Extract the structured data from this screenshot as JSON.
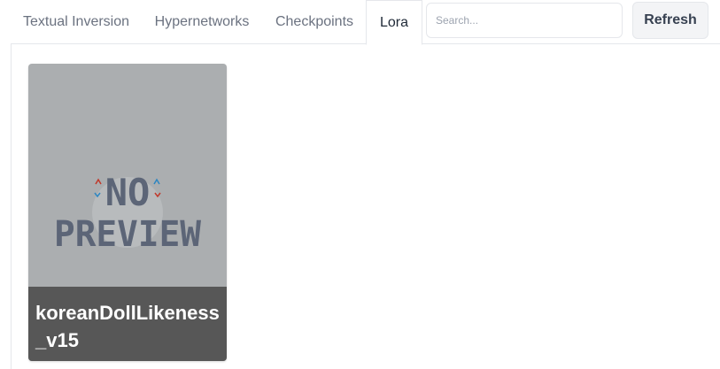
{
  "tabs": [
    {
      "label": "Textual Inversion",
      "active": false
    },
    {
      "label": "Hypernetworks",
      "active": false
    },
    {
      "label": "Checkpoints",
      "active": false
    },
    {
      "label": "Lora",
      "active": true
    }
  ],
  "search": {
    "placeholder": "Search...",
    "value": ""
  },
  "refresh_label": "Refresh",
  "cards": [
    {
      "name": "koreanDollLikeness_v15",
      "preview_text_line1": "NO",
      "preview_text_line2": "PREVIEW"
    }
  ],
  "colors": {
    "card_bg": "#abaeb0",
    "label_bg": "#575757",
    "preview_text": "#5c6577"
  }
}
